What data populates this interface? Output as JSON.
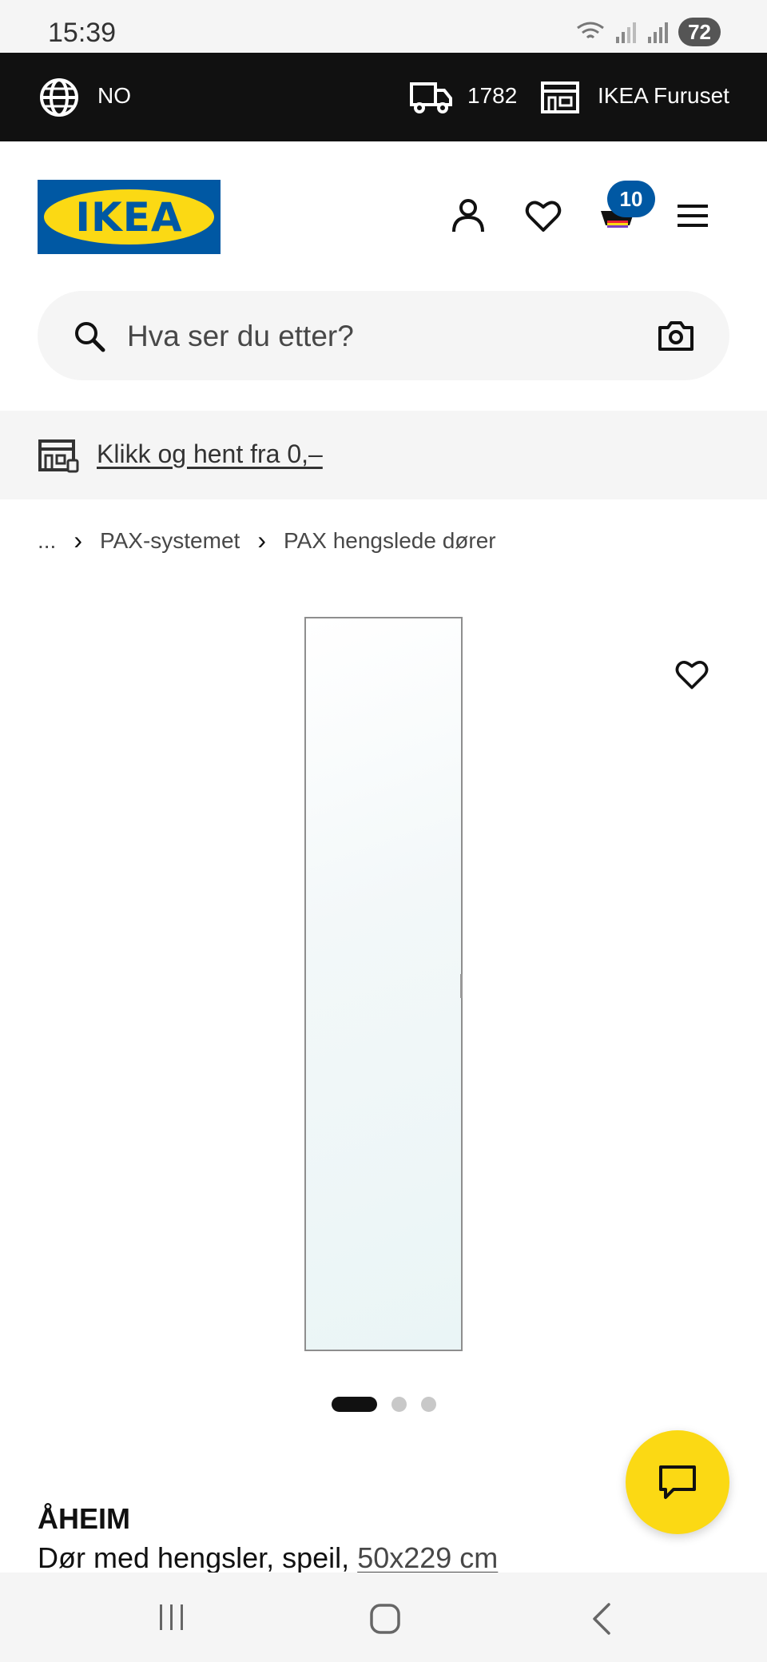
{
  "status": {
    "time": "15:39",
    "network": "6E",
    "battery": "72"
  },
  "topbar": {
    "language": "NO",
    "postal_code": "1782",
    "store": "IKEA Furuset"
  },
  "header": {
    "logo_text": "IKEA",
    "cart_count": "10",
    "brand_colors": {
      "blue": "#0058a3",
      "yellow": "#fbd914"
    }
  },
  "search": {
    "placeholder": "Hva ser du etter?"
  },
  "promo": {
    "click_collect": "Klikk og hent fra 0,–"
  },
  "breadcrumb": {
    "ellipsis": "...",
    "items": [
      "PAX-systemet",
      "PAX hengslede dører"
    ]
  },
  "gallery": {
    "image_count": 3,
    "active_index": 0
  },
  "product": {
    "name": "ÅHEIM",
    "description": "Dør med hengsler, speil,",
    "size": "50x229 cm"
  },
  "icons": [
    "globe-icon",
    "truck-icon",
    "store-icon",
    "user-icon",
    "heart-icon",
    "cart-icon",
    "menu-icon",
    "search-icon",
    "camera-icon",
    "chat-icon"
  ]
}
